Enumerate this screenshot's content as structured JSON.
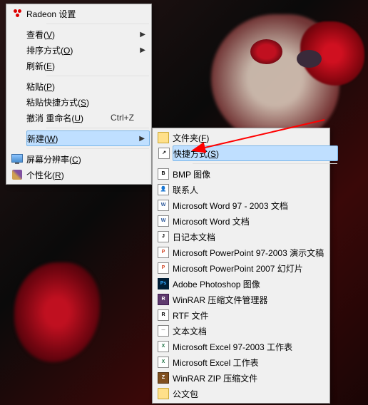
{
  "menu1": {
    "radeon": "Radeon 设置",
    "view": {
      "label": "查看",
      "accel": "V"
    },
    "sort": {
      "label": "排序方式",
      "accel": "O"
    },
    "refresh": {
      "label": "刷新",
      "accel": "E"
    },
    "paste": {
      "label": "粘贴",
      "accel": "P"
    },
    "pasteShortcut": {
      "label": "粘贴快捷方式",
      "accel": "S"
    },
    "undo": {
      "label": "撤消 重命名",
      "accel": "U",
      "shortcut": "Ctrl+Z"
    },
    "new": {
      "label": "新建",
      "accel": "W"
    },
    "resolution": {
      "label": "屏幕分辨率",
      "accel": "C"
    },
    "personalize": {
      "label": "个性化",
      "accel": "R"
    }
  },
  "menu2": {
    "folder": {
      "label": "文件夹",
      "accel": "F"
    },
    "shortcut": {
      "label": "快捷方式",
      "accel": "S"
    },
    "bmp": "BMP 图像",
    "contact": "联系人",
    "word97": "Microsoft Word 97 - 2003 文档",
    "word": "Microsoft Word 文档",
    "journal": "日记本文档",
    "ppt97": "Microsoft PowerPoint 97-2003 演示文稿",
    "ppt": "Microsoft PowerPoint 2007 幻灯片",
    "psd": "Adobe Photoshop 图像",
    "rar": "WinRAR 压缩文件管理器",
    "rtf": "RTF 文件",
    "txt": "文本文档",
    "xls97": "Microsoft Excel 97-2003 工作表",
    "xls": "Microsoft Excel 工作表",
    "zip": "WinRAR ZIP 压缩文件",
    "briefcase": "公文包"
  }
}
